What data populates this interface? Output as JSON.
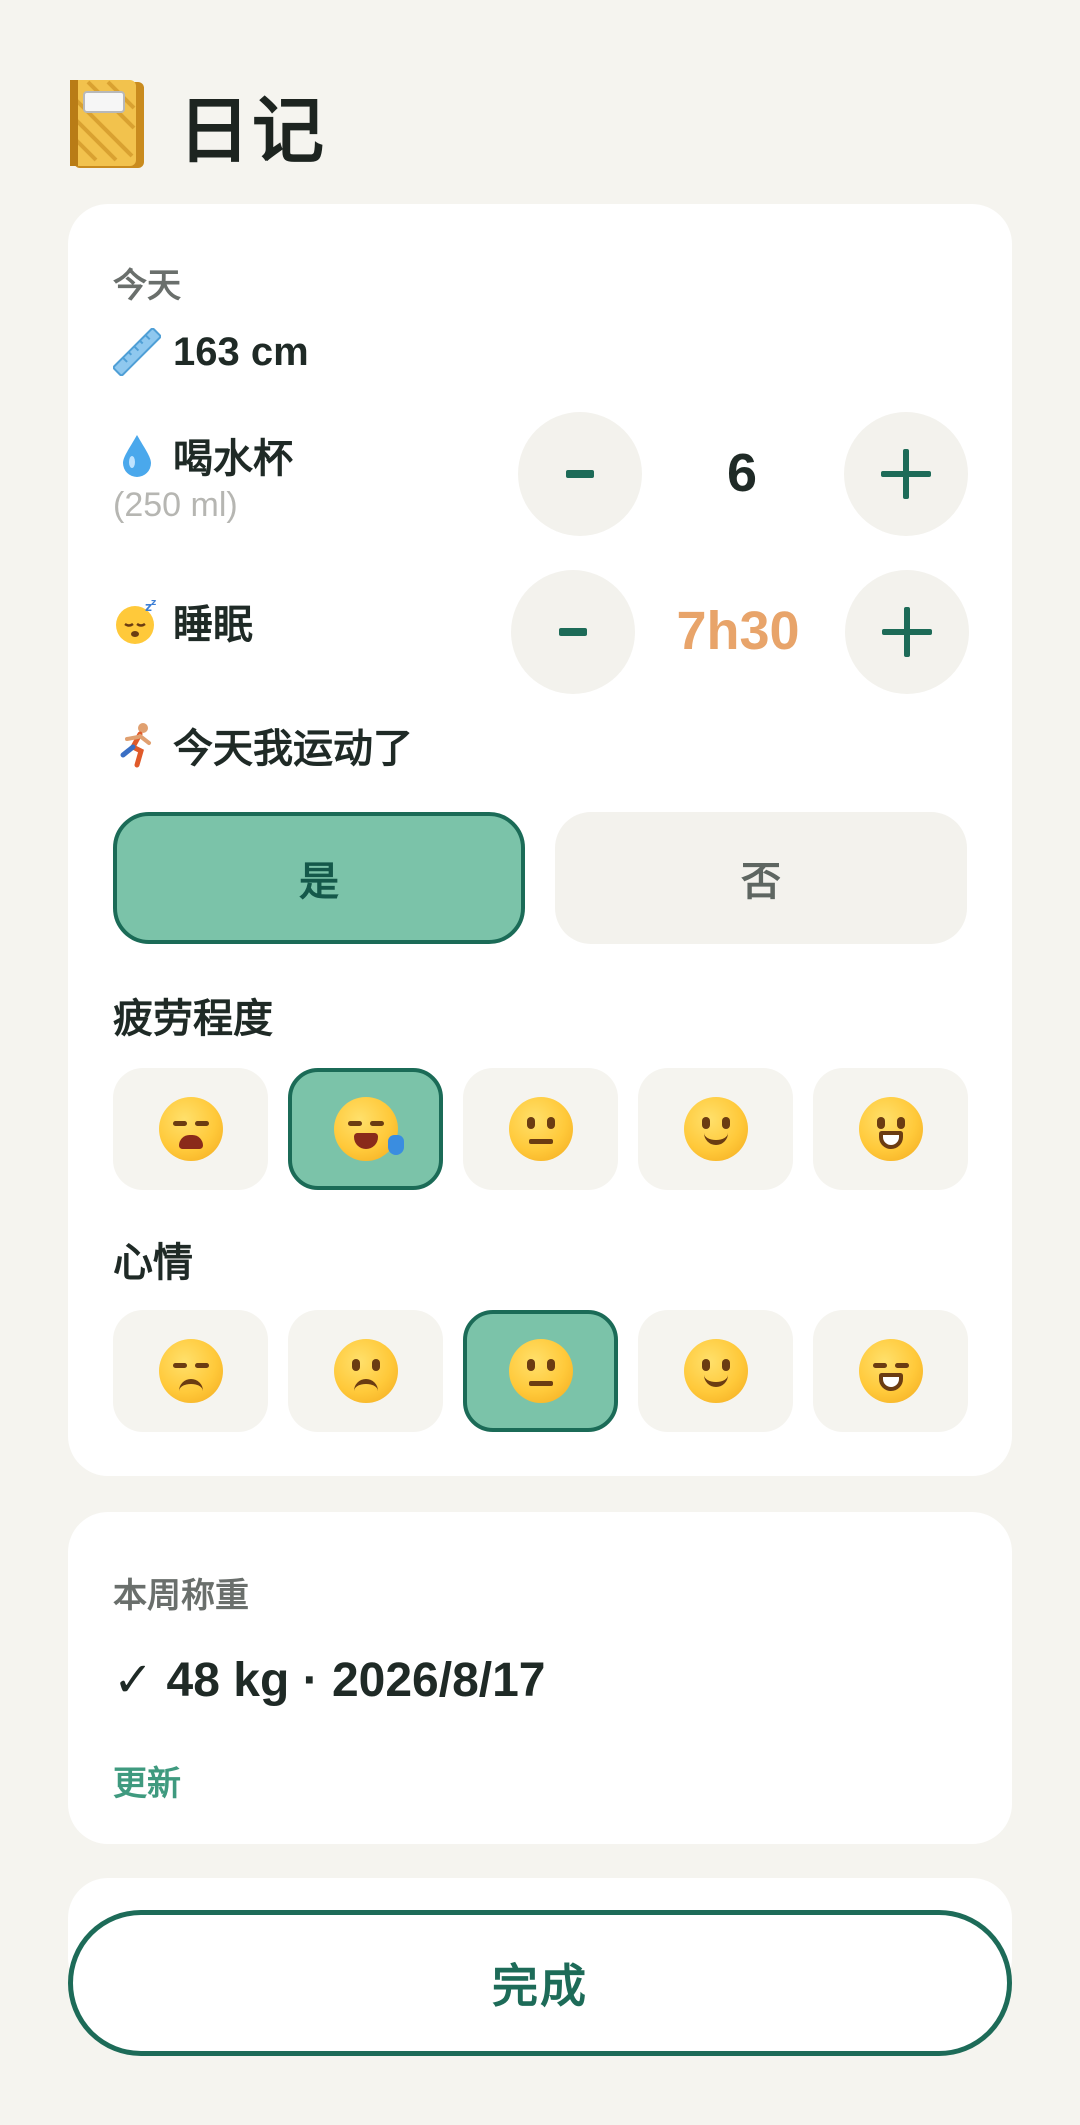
{
  "header": {
    "icon": "notebook-icon",
    "title": "日记"
  },
  "today": {
    "section_label": "今天",
    "height": {
      "icon": "ruler-icon",
      "value": "163 cm"
    },
    "water": {
      "icon": "droplet-icon",
      "label": "喝水杯",
      "sub_label": "(250 ml)",
      "minus_label": "-",
      "value": "6",
      "value_color": "#1d6b58"
    },
    "sleep": {
      "icon": "sleeping-face-icon",
      "label": "睡眠",
      "minus_label": "-",
      "value": "7h30",
      "value_color": "#e8a46a"
    },
    "exercise": {
      "icon": "runner-icon",
      "label": "今天我运动了",
      "options": [
        "是",
        "否"
      ],
      "selected": "是"
    },
    "fatigue": {
      "label": "疲劳程度",
      "options": [
        "weary-face-icon",
        "sleepy-face-icon",
        "neutral-face-icon",
        "slightly-smiling-face-icon",
        "grinning-face-icon"
      ],
      "selected_index": 1
    },
    "mood": {
      "label": "心情",
      "options": [
        "disappointed-face-icon",
        "confused-face-icon",
        "neutral-face-icon",
        "slightly-smiling-face-icon",
        "beaming-face-icon"
      ],
      "selected_index": 2
    }
  },
  "weekly_weight": {
    "section_label": "本周称重",
    "value": "✓ 48 kg · 2026/8/17",
    "update_label": "更新"
  },
  "footer": {
    "done_label": "完成"
  },
  "colors": {
    "accent": "#1d6b58",
    "selected_fill": "#7bc3a9",
    "sleep_value": "#e8a46a",
    "background": "#f5f4ef"
  }
}
